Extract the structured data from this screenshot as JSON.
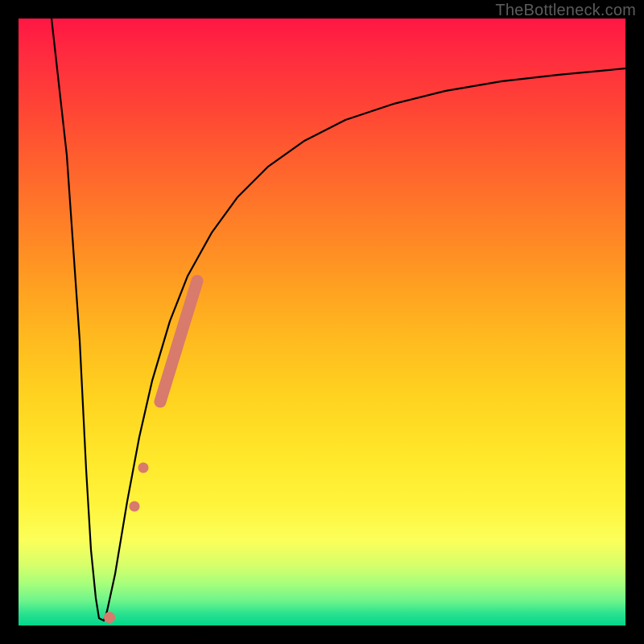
{
  "watermark": "TheBottleneck.com",
  "colors": {
    "curve": "#000000",
    "marker": "#d87a6c",
    "frame": "#000000"
  },
  "chart_data": {
    "type": "line",
    "title": "",
    "xlabel": "",
    "ylabel": "",
    "xlim": [
      0,
      100
    ],
    "ylim": [
      0,
      100
    ],
    "grid": false,
    "note": "No axis ticks or numeric labels are rendered; values below are read from pixel positions and normalised to 0–100.",
    "series": [
      {
        "name": "bottleneck-curve",
        "x": [
          5.5,
          8,
          10,
          11,
          12,
          13,
          14.5,
          16,
          18,
          20,
          22,
          25,
          28,
          32,
          36,
          41,
          47,
          54,
          62,
          71,
          80,
          90,
          100
        ],
        "y": [
          100,
          56,
          22,
          6,
          1,
          0.7,
          3,
          10,
          21,
          31,
          40,
          50,
          58,
          65,
          71,
          76,
          80,
          84,
          86.5,
          88.5,
          90,
          91,
          91.8
        ]
      }
    ],
    "markers": [
      {
        "name": "slab-top",
        "x_range": [
          23.5,
          29.5
        ],
        "y_range": [
          37,
          57
        ],
        "shape": "thick-line"
      },
      {
        "name": "dot-mid-1",
        "x": 20.5,
        "y": 26,
        "shape": "circle"
      },
      {
        "name": "dot-mid-2",
        "x": 19.2,
        "y": 20,
        "shape": "circle"
      },
      {
        "name": "dot-bottom",
        "x": 15.0,
        "y": 1.3,
        "shape": "circle"
      }
    ]
  }
}
